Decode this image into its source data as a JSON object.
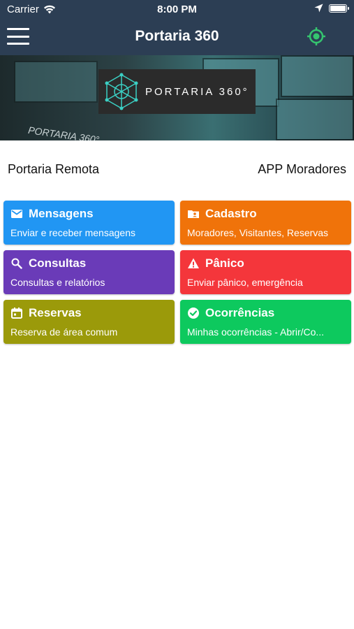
{
  "status_bar": {
    "carrier": "Carrier",
    "time": "8:00 PM"
  },
  "navbar": {
    "title": "Portaria 360"
  },
  "banner": {
    "logo_text": "PORTARIA 360°",
    "watermark": "PORTARIA 360°"
  },
  "info": {
    "left": "Portaria Remota",
    "right": "APP Moradores"
  },
  "colors": {
    "header": "#2c3e54",
    "mensagens": "#2196f3",
    "cadastro": "#f0730a",
    "consultas": "#6a3bb8",
    "panico": "#f4363b",
    "reservas": "#9b9a0a",
    "ocorrencias": "#0dc95e",
    "gps_accent": "#35c56f"
  },
  "cards": {
    "mensagens": {
      "title": "Mensagens",
      "subtitle": "Enviar e receber mensagens",
      "icon": "mail-icon"
    },
    "cadastro": {
      "title": "Cadastro",
      "subtitle": "Moradores, Visitantes, Reservas",
      "icon": "folder-user-icon"
    },
    "consultas": {
      "title": "Consultas",
      "subtitle": "Consultas e relatórios",
      "icon": "search-icon"
    },
    "panico": {
      "title": "Pânico",
      "subtitle": "Enviar pânico, emergência",
      "icon": "warning-icon"
    },
    "reservas": {
      "title": "Reservas",
      "subtitle": "Reserva de área comum",
      "icon": "calendar-icon"
    },
    "ocorrencias": {
      "title": "Ocorrências",
      "subtitle": "Minhas ocorrências - Abrir/Co...",
      "icon": "check-circle-icon"
    }
  }
}
